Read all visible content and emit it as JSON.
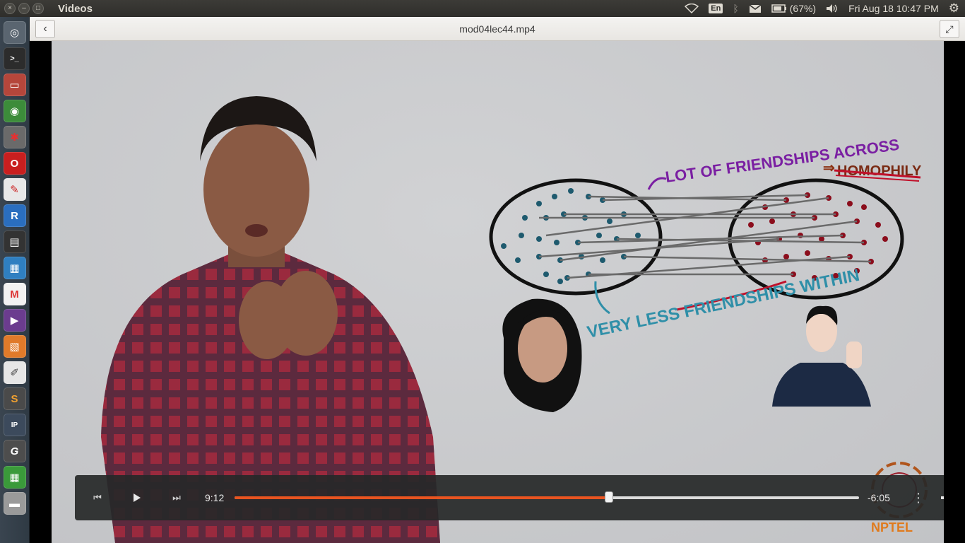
{
  "top_panel": {
    "app_title": "Videos",
    "keyboard": "En",
    "battery": "(67%)",
    "datetime": "Fri Aug 18 10:47 PM"
  },
  "header": {
    "file_title": "mod04lec44.mp4"
  },
  "player": {
    "elapsed": "9:12",
    "remaining": "-6:05",
    "progress": 0.6
  },
  "slide": {
    "annotation_across": "LOT OF FRIENDSHIPS ACROSS",
    "annotation_homophily": "HOMOPHILY",
    "annotation_within": "VERY LESS FRIENDSHIPS WITHIN",
    "logo_text": "NPTEL"
  },
  "colors": {
    "accent": "#e95420",
    "teal_dots": "#1e5a6e",
    "red_dots": "#8b0d1c",
    "purple_text": "#7a1fa2",
    "teal_text": "#2f8fa8"
  },
  "launcher": {
    "icons": [
      "dash-icon",
      "terminal-icon",
      "files-icon",
      "chrome-icon",
      "settings-icon",
      "opera-icon",
      "evince-icon",
      "r-icon",
      "video-icon",
      "writer-icon",
      "gmail-icon",
      "media-icon",
      "impress-icon",
      "text-editor-icon",
      "sublime-icon",
      "ipython-icon",
      "gp-icon",
      "calc-icon",
      "drive-icon",
      "stack-icon"
    ]
  }
}
